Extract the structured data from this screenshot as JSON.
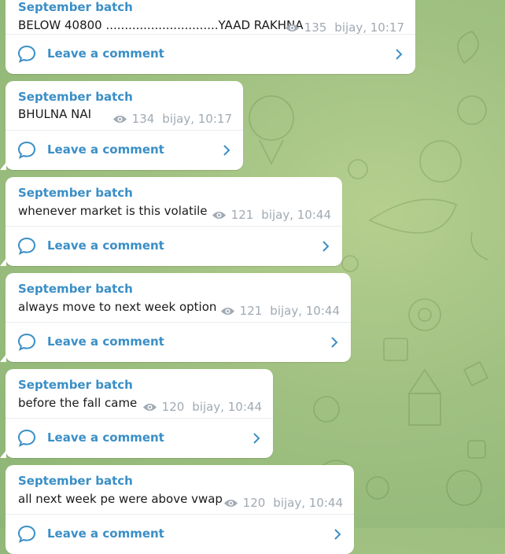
{
  "theme": {
    "accent": "#3a8fc6",
    "meta_color": "#a1aab3",
    "background": "#9fc081"
  },
  "messages": [
    {
      "author": "September batch",
      "text": "BELOW 40800 ..............................YAAD RAKHNA",
      "views": "135",
      "signature": "bijay, 10:17",
      "comment_label": "Leave a comment"
    },
    {
      "author": "September batch",
      "text": "BHULNA NAI",
      "views": "134",
      "signature": "bijay, 10:17",
      "comment_label": "Leave a comment"
    },
    {
      "author": "September batch",
      "text": "whenever market is this volatile",
      "views": "121",
      "signature": "bijay, 10:44",
      "comment_label": "Leave a comment"
    },
    {
      "author": "September batch",
      "text": "always move to next week option",
      "views": "121",
      "signature": "bijay, 10:44",
      "comment_label": "Leave a comment"
    },
    {
      "author": "September batch",
      "text": "before the fall came",
      "views": "120",
      "signature": "bijay, 10:44",
      "comment_label": "Leave a comment"
    },
    {
      "author": "September batch",
      "text": "all next week pe were above vwap",
      "views": "120",
      "signature": "bijay, 10:44",
      "comment_label": "Leave a comment"
    }
  ],
  "icons": {
    "views": "eye-icon",
    "comment": "comment-bubble-icon",
    "open": "chevron-right-icon"
  }
}
